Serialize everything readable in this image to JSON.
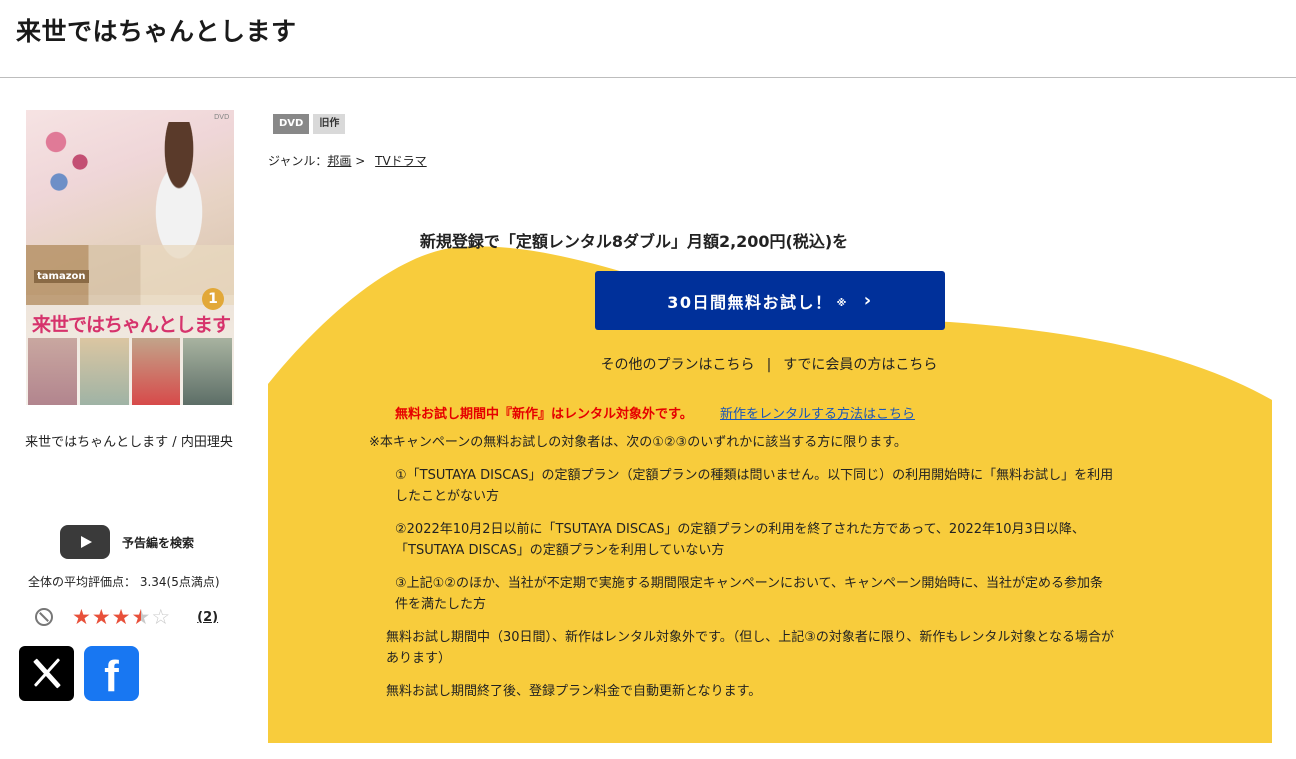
{
  "page": {
    "title": "来世ではちゃんとします"
  },
  "cover": {
    "logo_text": "来世ではちゃんとします",
    "box_label": "tamazon",
    "volume": "1",
    "dvd_mark": "DVD"
  },
  "product": {
    "caption": "来世ではちゃんとします / 内田理央"
  },
  "trailer": {
    "label": "予告編を検索"
  },
  "rating": {
    "average_text": "全体の平均評価点： 3.34(5点満点)",
    "value": 3.34,
    "max": 5,
    "review_count": "(2)"
  },
  "social": {
    "x_icon": "x-logo-icon",
    "facebook_icon": "facebook-logo-icon",
    "facebook_glyph": "f"
  },
  "tags": [
    {
      "label": "DVD"
    },
    {
      "label": "旧作"
    }
  ],
  "genre": {
    "prefix": "ジャンル：",
    "main": "邦画",
    "separator": ">",
    "sub": "TVドラマ"
  },
  "promo": {
    "headline": "新規登録で「定額レンタル8ダブル」月額2,200円(税込)を",
    "cta_label": "30日間無料お試し！",
    "cta_asterisk": "※",
    "cta_chevron": "›",
    "other_plans": "その他のプランはこちら",
    "link_separator": "|",
    "member_login": "すでに会員の方はこちら",
    "accent_color": "#00309a",
    "panel_color": "#f8cc3c"
  },
  "notes": {
    "red_warning": "無料お試し期間中『新作』はレンタル対象外です。",
    "new_release_link": "新作をレンタルする方法はこちら",
    "eligibility_heading": "※本キャンペーンの無料お試しの対象者は、次の①②③のいずれかに該当する方に限ります。",
    "item1_line1": "①「TSUTAYA DISCAS」の定額プラン（定額プランの種類は問いません。以下同じ）の利用開始時に「無料お試し」を利用",
    "item1_line2": "したことがない方",
    "item2_line1": "②2022年10月2日以前に「TSUTAYA DISCAS」の定額プランの利用を終了された方であって、2022年10月3日以降、",
    "item2_line2": "「TSUTAYA DISCAS」の定額プランを利用していない方",
    "item3_line1": "③上記①②のほか、当社が不定期で実施する期間限定キャンペーンにおいて、キャンペーン開始時に、当社が定める参加条",
    "item3_line2": "件を満たした方",
    "trial_period_line1": "無料お試し期間中（30日間）、新作はレンタル対象外です。（但し、上記③の対象者に限り、新作もレンタル対象となる場合が",
    "trial_period_line2": "あります）",
    "auto_renew": "無料お試し期間終了後、登録プラン料金で自動更新となります。"
  }
}
